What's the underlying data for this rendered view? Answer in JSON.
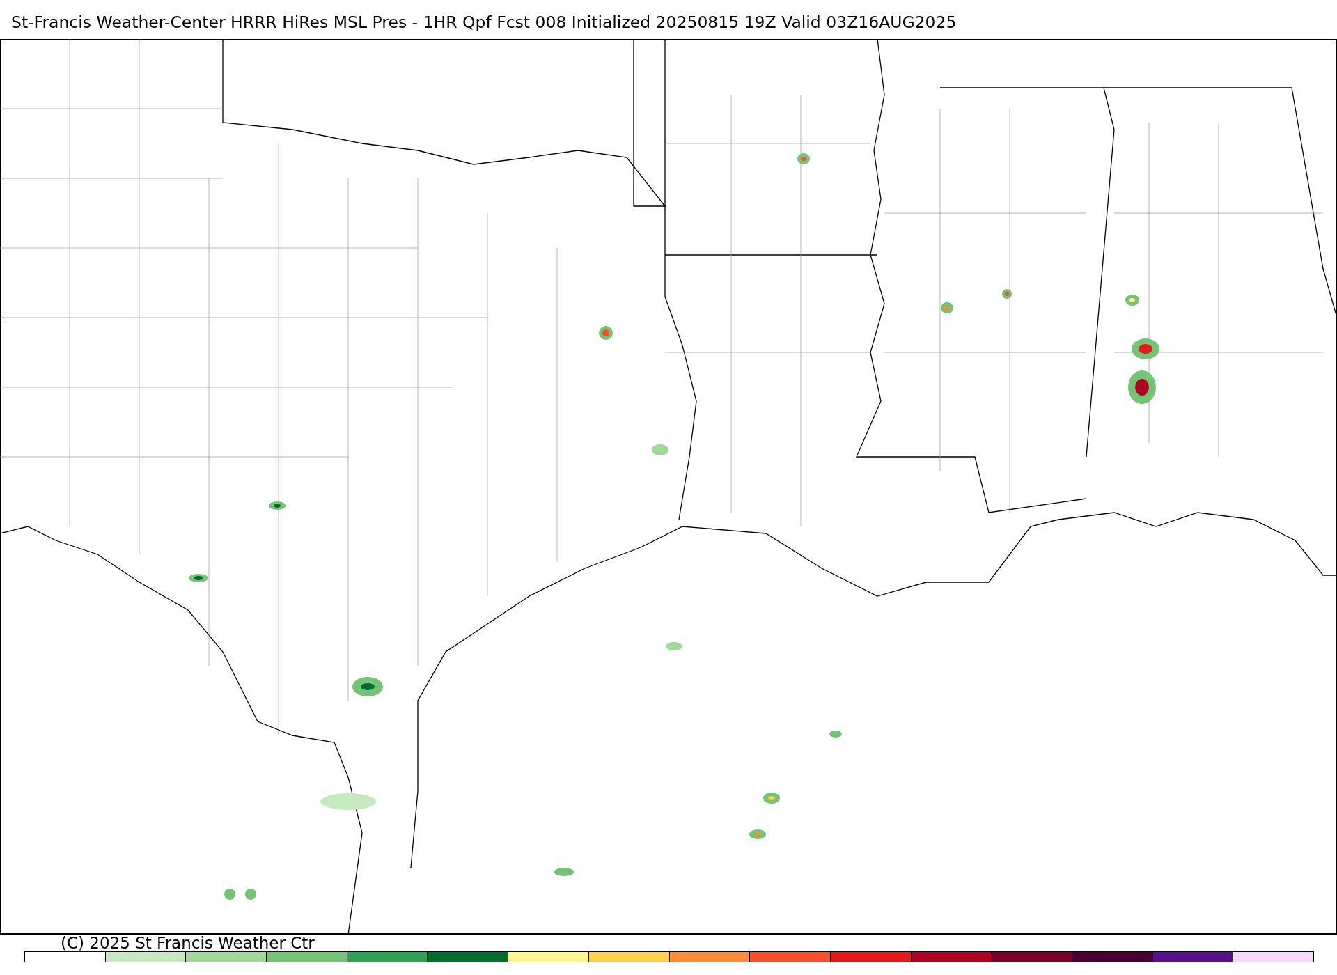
{
  "title": "St-Francis Weather-Center HRRR HiRes MSL Pres - 1HR Qpf Fcst 008 Initialized 20250815 19Z Valid 03Z16AUG2025",
  "copyright": "(C) 2025 St Francis Weather Ctr",
  "legend": [
    {
      "color": "#ffffff"
    },
    {
      "color": "#c7e9c0"
    },
    {
      "color": "#a1d99b"
    },
    {
      "color": "#74c476"
    },
    {
      "color": "#31a354"
    },
    {
      "color": "#006d2c"
    },
    {
      "color": "#fff68f"
    },
    {
      "color": "#ffcf4d"
    },
    {
      "color": "#fd8d3c"
    },
    {
      "color": "#fc4e2a"
    },
    {
      "color": "#e31a1c"
    },
    {
      "color": "#b10026"
    },
    {
      "color": "#7a0028"
    },
    {
      "color": "#4a0035"
    },
    {
      "color": "#5a0f8a"
    },
    {
      "color": "#f8d8fa"
    }
  ]
}
